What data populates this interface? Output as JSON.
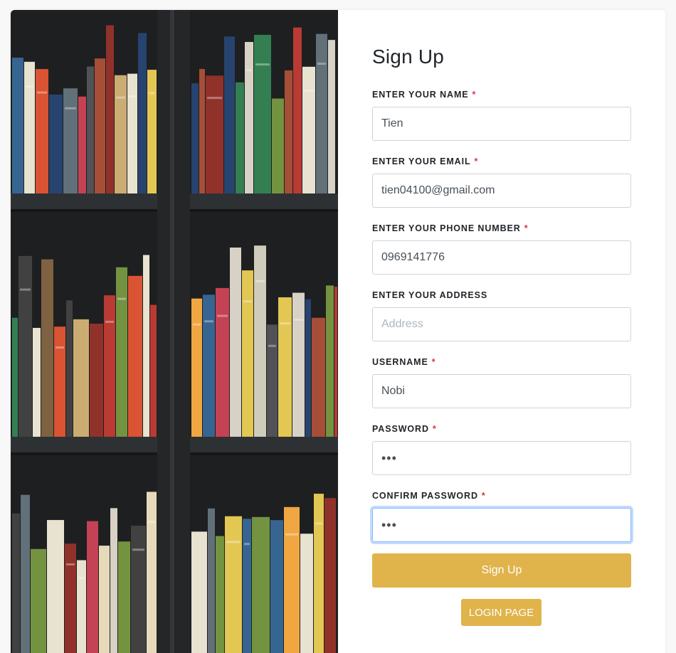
{
  "form": {
    "title": "Sign Up",
    "required_marker": "*",
    "fields": [
      {
        "label": "ENTER YOUR NAME",
        "required": true,
        "value": "Tien",
        "placeholder": "",
        "type": "text"
      },
      {
        "label": "ENTER YOUR EMAIL",
        "required": true,
        "value": "tien04100@gmail.com",
        "placeholder": "",
        "type": "text"
      },
      {
        "label": "ENTER YOUR PHONE NUMBER",
        "required": true,
        "value": "0969141776",
        "placeholder": "",
        "type": "text"
      },
      {
        "label": "ENTER YOUR ADDRESS",
        "required": false,
        "value": "",
        "placeholder": "Address",
        "type": "text"
      },
      {
        "label": "USERNAME",
        "required": true,
        "value": "Nobi",
        "placeholder": "",
        "type": "text"
      },
      {
        "label": "PASSWORD",
        "required": true,
        "value": "•••",
        "placeholder": "",
        "type": "password"
      },
      {
        "label": "CONFIRM PASSWORD",
        "required": true,
        "value": "•••",
        "placeholder": "",
        "type": "password"
      }
    ],
    "signup_label": "Sign Up",
    "login_label": "LOGIN PAGE"
  },
  "colors": {
    "accent": "#e0b34b",
    "required": "#dc3545",
    "focus_border": "#86b7fe"
  }
}
